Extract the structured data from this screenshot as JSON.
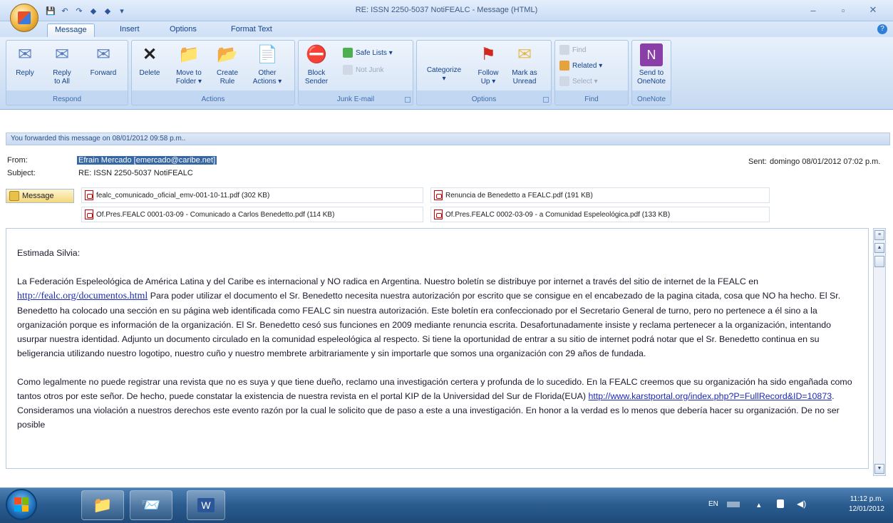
{
  "window": {
    "title": "RE: ISSN 2250-5037 NotiFEALC - Message (HTML)",
    "controls": [
      "–",
      "▫",
      "✕"
    ]
  },
  "tabs": [
    "Message",
    "Insert",
    "Options",
    "Format Text"
  ],
  "active_tab": "Message",
  "ribbon": {
    "respond": {
      "title": "Respond",
      "reply": "Reply",
      "reply_all": "Reply\nto All",
      "forward": "Forward"
    },
    "actions": {
      "title": "Actions",
      "delete": "Delete",
      "move": "Move to\nFolder ▾",
      "create_rule": "Create\nRule",
      "other": "Other\nActions ▾"
    },
    "junk": {
      "title": "Junk E-mail",
      "block": "Block\nSender",
      "safe_lists": "Safe Lists ▾",
      "not_junk": "Not Junk"
    },
    "options": {
      "title": "Options",
      "categorize": "Categorize\n▾",
      "follow_up": "Follow\nUp ▾",
      "mark_unread": "Mark as\nUnread"
    },
    "find": {
      "title": "Find",
      "find": "Find",
      "related": "Related ▾",
      "select": "Select ▾"
    },
    "onenote": {
      "title": "OneNote",
      "send": "Send to\nOneNote"
    }
  },
  "infobar": "You forwarded this message on 08/01/2012 09:58 p.m..",
  "header": {
    "from_label": "From:",
    "from_value": "Efrain Mercado [emercado@caribe.net]",
    "subject_label": "Subject:",
    "subject_value": "RE: ISSN 2250-5037 NotiFEALC",
    "sent_label": "Sent:",
    "sent_value": "domingo 08/01/2012 07:02 p.m."
  },
  "attachments": {
    "message_tab": "Message",
    "files": [
      "fealc_comunicado_oficial_emv-001-10-11.pdf (302 KB)",
      "Renuncia de Benedetto a FEALC.pdf (191 KB)",
      "Of.Pres.FEALC 0001-03-09 - Comunicado a Carlos Benedetto.pdf (114 KB)",
      "Of.Pres.FEALC 0002-03-09 - a Comunidad Espeleológica.pdf (133 KB)"
    ]
  },
  "body": {
    "greeting": "Estimada Silvia:",
    "p1_a": "La Federación Espeleológica de América Latina y del Caribe es internacional y NO radica en Argentina. Nuestro boletín se distribuye por internet a través del sitio de internet de la FEALC en ",
    "p1_link": "http://fealc.org/documentos.html",
    "p1_b": " Para poder utilizar el documento el Sr. Benedetto necesita nuestra autorización por escrito que se consigue en el encabezado de la pagina citada, cosa que NO ha hecho. El Sr. Benedetto ha colocado una sección en su página web identificada como FEALC sin nuestra autorización. Este boletín era confeccionado por el Secretario General de turno, pero no pertenece a él sino a la organización porque es información de la organización. El Sr. Benedetto cesó sus funciones en 2009 mediante renuncia escrita. Desafortunadamente insiste y reclama pertenecer a la organización, intentando usurpar nuestra identidad. Adjunto un documento circulado en la comunidad espeleológica al respecto. Si tiene la oportunidad de entrar a su sitio de internet podrá notar que el Sr. Benedetto continua en su beligerancia utilizando nuestro logotipo, nuestro cuño y nuestro membrete arbitrariamente y sin importarle que somos una organización con 29 años de fundada.",
    "p2_a": "Como legalmente no puede registrar una revista que no es suya y que tiene dueño, reclamo una investigación certera y profunda de lo sucedido. En la FEALC creemos que su organización ha sido engañada como tantos otros por este señor. De hecho, puede constatar la existencia de nuestra revista en el portal KIP de la Universidad del Sur de Florida(EUA) ",
    "p2_link": "http://www.karstportal.org/index.php?P=FullRecord&ID=10873",
    "p2_b": ". Consideramos una violación a nuestros derechos este evento razón por la cual le solicito que de paso a este a una investigación. En honor a la verdad es lo menos que debería hacer su organización. De no ser posible"
  },
  "taskbar": {
    "lang": "EN",
    "time": "11:12 p.m.",
    "date": "12/01/2012"
  }
}
